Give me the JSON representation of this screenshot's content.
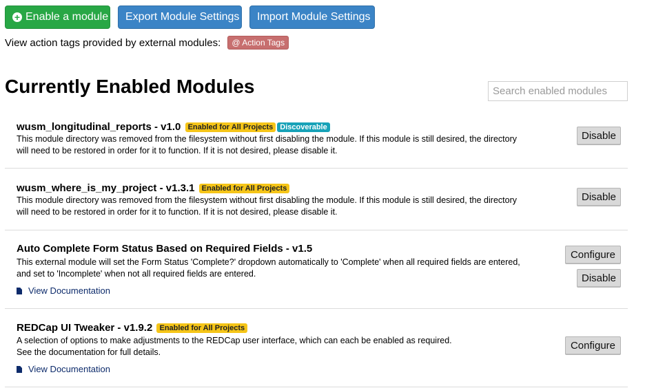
{
  "toolbar": {
    "enable_label": "Enable a module",
    "export_label": "Export Module Settings",
    "import_label": "Import Module Settings"
  },
  "action_tags": {
    "text": "View action tags provided by external modules:",
    "badge": "@ Action Tags"
  },
  "page_title": "Currently Enabled Modules",
  "search": {
    "placeholder": "Search enabled modules"
  },
  "modules": [
    {
      "title": "wusm_longitudinal_reports - v1.0",
      "badges": [
        "Enabled for All Projects",
        "Discoverable"
      ],
      "description": [
        "This module directory was removed from the filesystem without first disabling the module. If this module is still desired, the directory",
        "will need to be restored in order for it to function. If it is not desired, please disable it."
      ],
      "buttons": [
        "Disable"
      ]
    },
    {
      "title": "wusm_where_is_my_project - v1.3.1",
      "badges": [
        "Enabled for All Projects"
      ],
      "description": [
        "This module directory was removed from the filesystem without first disabling the module. If this module is still desired, the directory",
        "will need to be restored in order for it to function. If it is not desired, please disable it."
      ],
      "buttons": [
        "Disable"
      ]
    },
    {
      "title": "Auto Complete Form Status Based on Required Fields - v1.5",
      "badges": [],
      "description": [
        "This external module will set the Form Status 'Complete?' dropdown automatically to 'Complete' when all required fields are entered,",
        "and set to 'Incomplete' when not all required fields are entered."
      ],
      "doc_link": "View Documentation",
      "buttons": [
        "Configure",
        "Disable"
      ]
    },
    {
      "title": "REDCap UI Tweaker - v1.9.2",
      "badges": [
        "Enabled for All Projects"
      ],
      "description": [
        "A selection of options to make adjustments to the REDCap user interface, which can each be enabled as required.",
        "See the documentation for full details."
      ],
      "doc_link": "View Documentation",
      "buttons": [
        "Configure"
      ]
    }
  ]
}
